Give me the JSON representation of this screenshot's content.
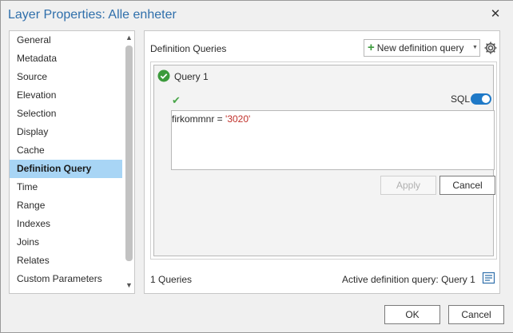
{
  "window": {
    "title": "Layer Properties: Alle enheter",
    "close_glyph": "✕"
  },
  "sidebar": {
    "items": [
      {
        "label": "General"
      },
      {
        "label": "Metadata"
      },
      {
        "label": "Source"
      },
      {
        "label": "Elevation"
      },
      {
        "label": "Selection"
      },
      {
        "label": "Display"
      },
      {
        "label": "Cache"
      },
      {
        "label": "Definition Query",
        "selected": true
      },
      {
        "label": "Time"
      },
      {
        "label": "Range"
      },
      {
        "label": "Indexes"
      },
      {
        "label": "Joins"
      },
      {
        "label": "Relates"
      },
      {
        "label": "Custom Parameters"
      }
    ],
    "scroll_up_glyph": "▲",
    "scroll_down_glyph": "▼"
  },
  "panel": {
    "title": "Definition Queries",
    "new_query_label": "New definition query",
    "new_query_icon": "plus-icon",
    "dropdown_glyph": "▼",
    "settings_icon": "gear-icon",
    "query": {
      "name": "Query 1",
      "status_icon": "check-circle-icon",
      "valid_glyph": "✔",
      "sql_label": "SQL",
      "sql_toggle_on": true,
      "expression_field": "firkommnr",
      "expression_operator": " = ",
      "expression_value": "'3020'",
      "apply_label": "Apply",
      "cancel_label": "Cancel"
    },
    "count_label": "1 Queries",
    "active_label": "Active definition query: Query 1",
    "active_icon": "list-icon"
  },
  "footer": {
    "ok_label": "OK",
    "cancel_label": "Cancel"
  },
  "colors": {
    "title": "#2f6fab",
    "selected": "#a8d5f5",
    "toggle": "#1f79c7",
    "success": "#3c9a3c",
    "sql_value": "#c0302a"
  }
}
